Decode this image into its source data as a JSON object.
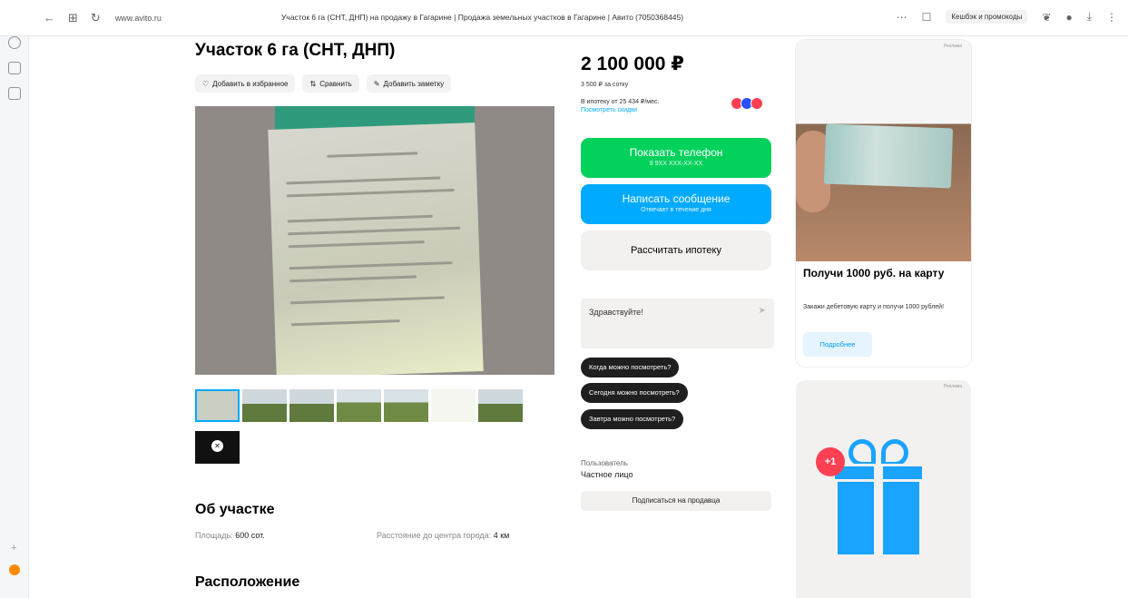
{
  "browser": {
    "address": "www.avito.ru",
    "tab_title": "Участок 6 га (СНТ, ДНП) на продажу в Гагарине | Продажа земельных участков в Гагарине | Авито (7050368445)",
    "cashback": "Кешбэк и промокоды"
  },
  "listing": {
    "title": "Участок 6 га (СНТ, ДНП)",
    "actions": {
      "favorite": "Добавить в избранное",
      "compare": "Сравнить",
      "note": "Добавить заметку"
    },
    "about_heading": "Об участке",
    "area_label": "Площадь:",
    "area_value": "600 сот.",
    "distance_label": "Расстояние до центра города:",
    "distance_value": "4 км",
    "location_heading": "Расположение"
  },
  "pricing": {
    "price": "2 100 000 ₽",
    "per_unit": "3 500 ₽ за сотку",
    "installment": "В ипотеку от 25 434 ₽/мес.",
    "installment_link": "Посмотреть скидки",
    "phone_button": "Показать телефон",
    "phone_sub": "8 9XX XXX-XX-XX",
    "message_button": "Написать сообщение",
    "message_sub": "Отвечает в течение дня",
    "mortgage_button": "Рассчитать ипотеку"
  },
  "chat": {
    "greeting": "Здравствуйте!",
    "chips": [
      "Когда можно посмотреть?",
      "Сегодня можно посмотреть?",
      "Завтра можно посмотреть?"
    ]
  },
  "seller": {
    "label": "Пользователь",
    "name": "Частное лицо",
    "subscribe": "Подписаться на продавца"
  },
  "ads": {
    "mark": "Реклама",
    "card1_title": "Получи 1000 руб. на карту",
    "card1_desc": "Закажи дебетовую карту и получи 1000 рублей!",
    "card1_button": "Подробнее",
    "card2_badge": "+1"
  },
  "colors": {
    "green": "#02d15c",
    "blue": "#00aaff",
    "accent_red": "#ff4053"
  }
}
